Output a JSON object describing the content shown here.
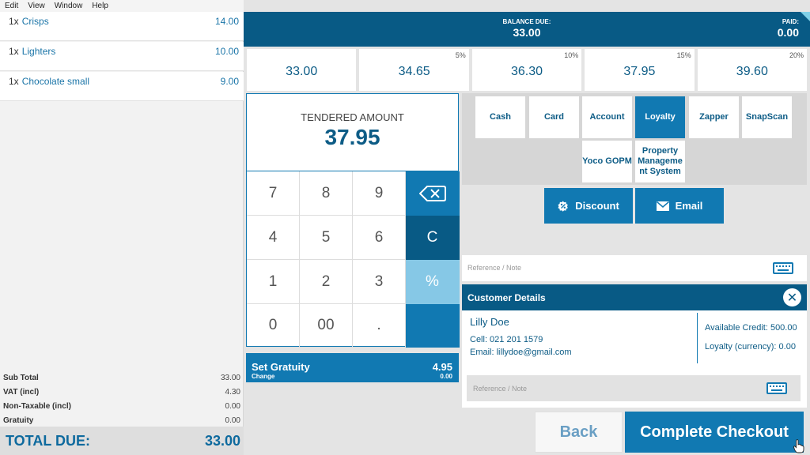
{
  "menu": [
    "Edit",
    "View",
    "Window",
    "Help"
  ],
  "order_items": [
    {
      "qty": "1x",
      "name": "Crisps",
      "price": "14.00"
    },
    {
      "qty": "1x",
      "name": "Lighters",
      "price": "10.00"
    },
    {
      "qty": "1x",
      "name": "Chocolate small",
      "price": "9.00"
    }
  ],
  "totals": {
    "subtotal_label": "Sub Total",
    "subtotal": "33.00",
    "vat_label": "VAT (incl)",
    "vat": "4.30",
    "nontax_label": "Non-Taxable (incl)",
    "nontax": "0.00",
    "gratuity_label": "Gratuity",
    "gratuity": "0.00",
    "total_due_label": "TOTAL DUE:",
    "total_due": "33.00"
  },
  "balance": {
    "label": "BALANCE DUE:",
    "value": "33.00",
    "paid_label": "PAID:",
    "paid_value": "0.00"
  },
  "amount_options": [
    {
      "pct": "",
      "value": "33.00"
    },
    {
      "pct": "5%",
      "value": "34.65"
    },
    {
      "pct": "10%",
      "value": "36.30"
    },
    {
      "pct": "15%",
      "value": "37.95"
    },
    {
      "pct": "20%",
      "value": "39.60"
    }
  ],
  "tendered": {
    "label": "TENDERED AMOUNT",
    "value": "37.95"
  },
  "keypad": {
    "k7": "7",
    "k8": "8",
    "k9": "9",
    "k4": "4",
    "k5": "5",
    "k6": "6",
    "k1": "1",
    "k2": "2",
    "k3": "3",
    "k0": "0",
    "k00": "00",
    "kdot": ".",
    "clear": "C",
    "percent": "%"
  },
  "gratuity": {
    "label": "Set Gratuity",
    "sub": "Change",
    "value": "4.95",
    "sub_value": "0.00"
  },
  "methods": {
    "cash": "Cash",
    "card": "Card",
    "account": "Account",
    "loyalty": "Loyalty",
    "zapper": "Zapper",
    "snapscan": "SnapScan",
    "yoco": "Yoco GOPM",
    "property": "Property Manageme nt System"
  },
  "actions": {
    "discount": "Discount",
    "email": "Email"
  },
  "reference": {
    "placeholder": "Reference / Note"
  },
  "customer": {
    "title": "Customer Details",
    "name": "Lilly Doe",
    "cell": "Cell: 021 201 1579",
    "email": "Email: lillydoe@gmail.com",
    "credit": "Available Credit: 500.00",
    "loyalty": "Loyalty (currency): 0.00",
    "ref_placeholder": "Reference / Note"
  },
  "buttons": {
    "back": "Back",
    "checkout": "Complete Checkout"
  },
  "colors": {
    "primary": "#1179b2",
    "dark": "#085a85",
    "light": "#86c8e6"
  }
}
